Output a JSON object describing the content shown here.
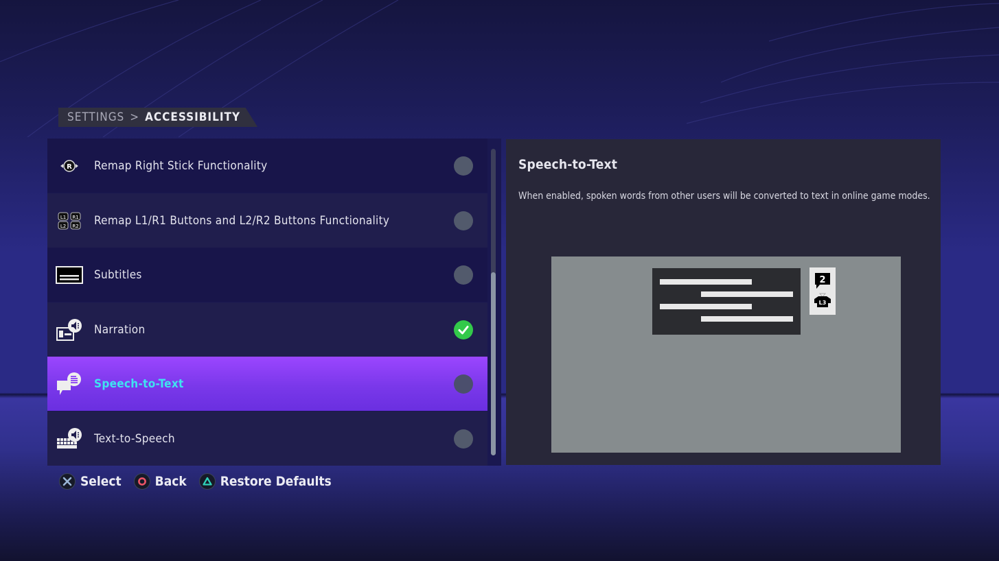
{
  "breadcrumb": {
    "root": "SETTINGS",
    "separator": ">",
    "current": "ACCESSIBILITY"
  },
  "settings_list": {
    "items": [
      {
        "label": "Remap Right Stick Functionality",
        "icon": "right-stick-icon",
        "enabled": false,
        "selected": false
      },
      {
        "label": "Remap L1/R1 Buttons and L2/R2 Buttons Functionality",
        "icon": "shoulder-buttons-icon",
        "enabled": false,
        "selected": false
      },
      {
        "label": "Subtitles",
        "icon": "subtitles-icon",
        "enabled": false,
        "selected": false
      },
      {
        "label": "Narration",
        "icon": "narration-icon",
        "enabled": true,
        "selected": false
      },
      {
        "label": "Speech-to-Text",
        "icon": "speech-to-text-icon",
        "enabled": false,
        "selected": true
      },
      {
        "label": "Text-to-Speech",
        "icon": "text-to-speech-icon",
        "enabled": false,
        "selected": false
      }
    ],
    "shoulder_icon_labels": [
      "L1",
      "R1",
      "L2",
      "R2"
    ],
    "stick_icon_label": "R"
  },
  "detail": {
    "title": "Speech-to-Text",
    "description": "When enabled, spoken words from other users will be converted to text in online game modes.",
    "preview": {
      "chat_count": "2",
      "player_badge": "L3"
    }
  },
  "footer": {
    "buttons": [
      {
        "glyph": "✕",
        "label": "Select",
        "color": "#8fb4d9"
      },
      {
        "glyph": "○",
        "label": "Back",
        "color": "#ec5466"
      },
      {
        "glyph": "△",
        "label": "Restore Defaults",
        "color": "#2fd1b8"
      }
    ]
  },
  "colors": {
    "selected_label": "#3fe3f0",
    "toggle_on": "#33c94a",
    "toggle_off": "#525a6c",
    "selected_row_top": "#9b46ff",
    "selected_row_bottom": "#6a2fe0"
  }
}
